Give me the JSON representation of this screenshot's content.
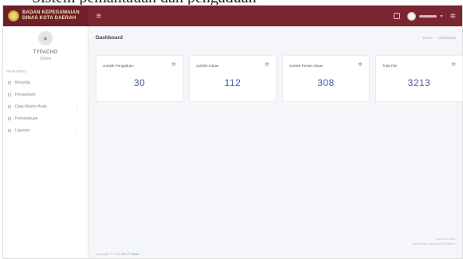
{
  "caption": "Sistem pemantauan dan pengaduan",
  "app": {
    "brand_lines": [
      "BADAN KEPEGAWAIAN",
      "DINAS KOTA DAERAH"
    ],
    "hamburger_icon": "menu-icon",
    "user_name_placeholder": "",
    "accent": "#7a2630"
  },
  "sidebar": {
    "profile_name": "TYPACHO",
    "profile_status": "Online",
    "section_label": "MAIN MENU",
    "items": [
      {
        "label": "Beranda",
        "has_chevron": false
      },
      {
        "label": "Pengaduan",
        "has_chevron": false
      },
      {
        "label": "Data Master Arsip",
        "has_chevron": true
      },
      {
        "label": "Pemantauan",
        "has_chevron": false
      },
      {
        "label": "Laporan",
        "has_chevron": true
      }
    ]
  },
  "main": {
    "title": "Dashboard",
    "breadcrumb": [
      "Home",
      "Dashboard"
    ],
    "cards": [
      {
        "label": "Jumlah Pengaduan",
        "value": "30"
      },
      {
        "label": "Jumlah Aduan",
        "value": "112"
      },
      {
        "label": "Jumlah Pesan Aduan",
        "value": "308"
      },
      {
        "label": "Total File",
        "value": "3213"
      }
    ],
    "right_note_lines": [
      "Laporan Data",
      "Diterbitkan oleh Admin Sistem"
    ],
    "footer_prefix": "Copyright © 2019 ",
    "footer_link": "Tim IT Dinas"
  }
}
